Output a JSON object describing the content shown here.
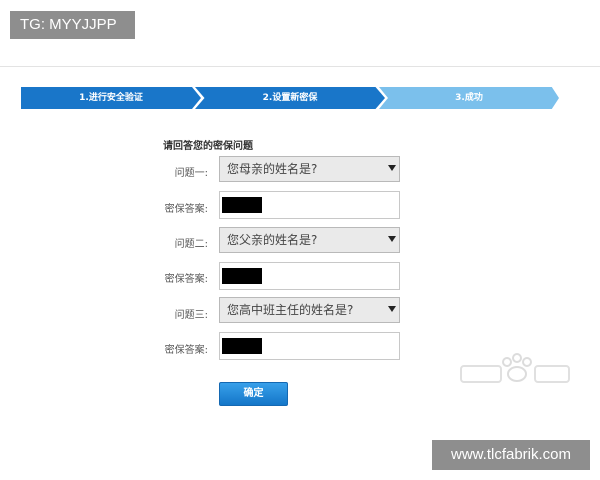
{
  "overlay": {
    "top_left_tag": "TG: MYYJJPP",
    "bottom_right_tag": "www.tlcfabrik.com"
  },
  "steps": [
    {
      "label": "1.进行安全验证",
      "state": "done"
    },
    {
      "label": "2.设置新密保",
      "state": "current"
    },
    {
      "label": "3.成功",
      "state": "pending"
    }
  ],
  "form": {
    "title": "请回答您的密保问题",
    "questions": [
      {
        "label": "问题一:",
        "selected": "您母亲的姓名是?",
        "answer_label": "密保答案:"
      },
      {
        "label": "问题二:",
        "selected": "您父亲的姓名是?",
        "answer_label": "密保答案:"
      },
      {
        "label": "问题三:",
        "selected": "您高中班主任的姓名是?",
        "answer_label": "密保答案:"
      }
    ],
    "submit_label": "确定"
  },
  "colors": {
    "step_active": "#1976c9",
    "step_pending": "#7bc0ec",
    "button": "#1476c8"
  }
}
